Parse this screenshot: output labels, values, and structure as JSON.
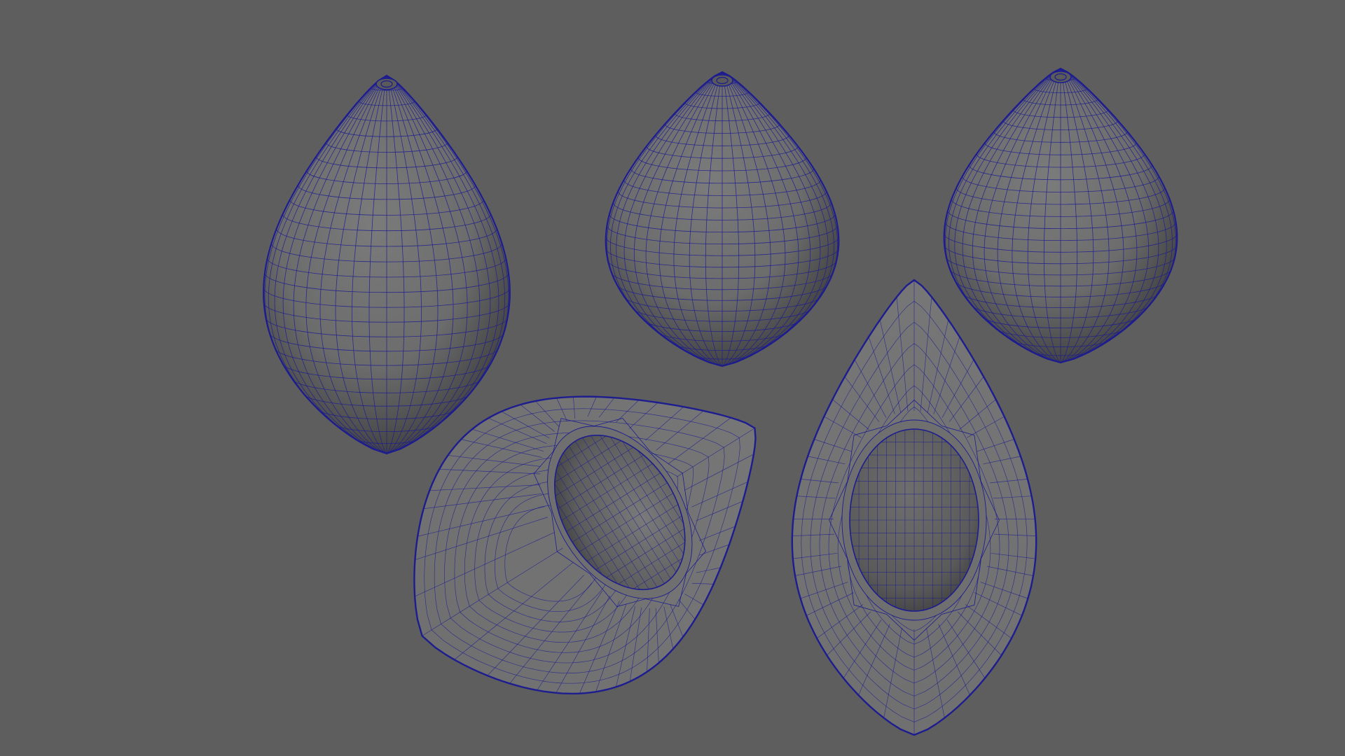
{
  "viewport": {
    "background_color": "#5e5e5e",
    "shade_color": "#747474",
    "wire_color": "#1d1d8f",
    "objects": [
      {
        "name": "avocado-whole-left",
        "kind": "whole"
      },
      {
        "name": "avocado-whole-center",
        "kind": "whole"
      },
      {
        "name": "avocado-whole-right",
        "kind": "whole"
      },
      {
        "name": "avocado-half-tilted",
        "kind": "half-with-pit-cavity"
      },
      {
        "name": "avocado-half-upright",
        "kind": "half-with-pit-cavity"
      }
    ]
  }
}
